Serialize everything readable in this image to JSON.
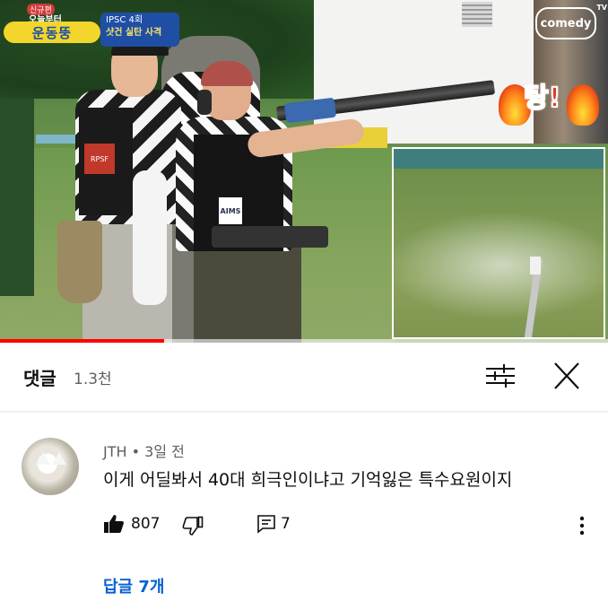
{
  "video": {
    "show_badge": "신규편",
    "show_title_line1": "오늘부터",
    "show_title_main": "운동뚱",
    "episode_line1": "IPSC 4회",
    "episode_line2": "샷건 실탄 사격",
    "channel_logo": "comedy",
    "channel_logo_sup": "TV",
    "caption_bang": "탕!",
    "patch_text": "RPSF",
    "vest_logo": "AIMS",
    "progress_fraction": 0.27
  },
  "comments_panel": {
    "title": "댓글",
    "count": "1.3천",
    "filter_icon": "filter-sliders-icon",
    "close_icon": "close-icon"
  },
  "comment": {
    "author": "JTH",
    "separator": "•",
    "time": "3일 전",
    "text": "이게 어딜봐서 40대 희극인이냐고 기억잃은 특수요원이지",
    "like_count": "807",
    "reply_count": "7",
    "replies_link": "답글 7개"
  },
  "colors": {
    "accent_link": "#065fd4",
    "progress": "#ff0000",
    "text_primary": "#0f0f0f",
    "text_secondary": "#606060"
  }
}
